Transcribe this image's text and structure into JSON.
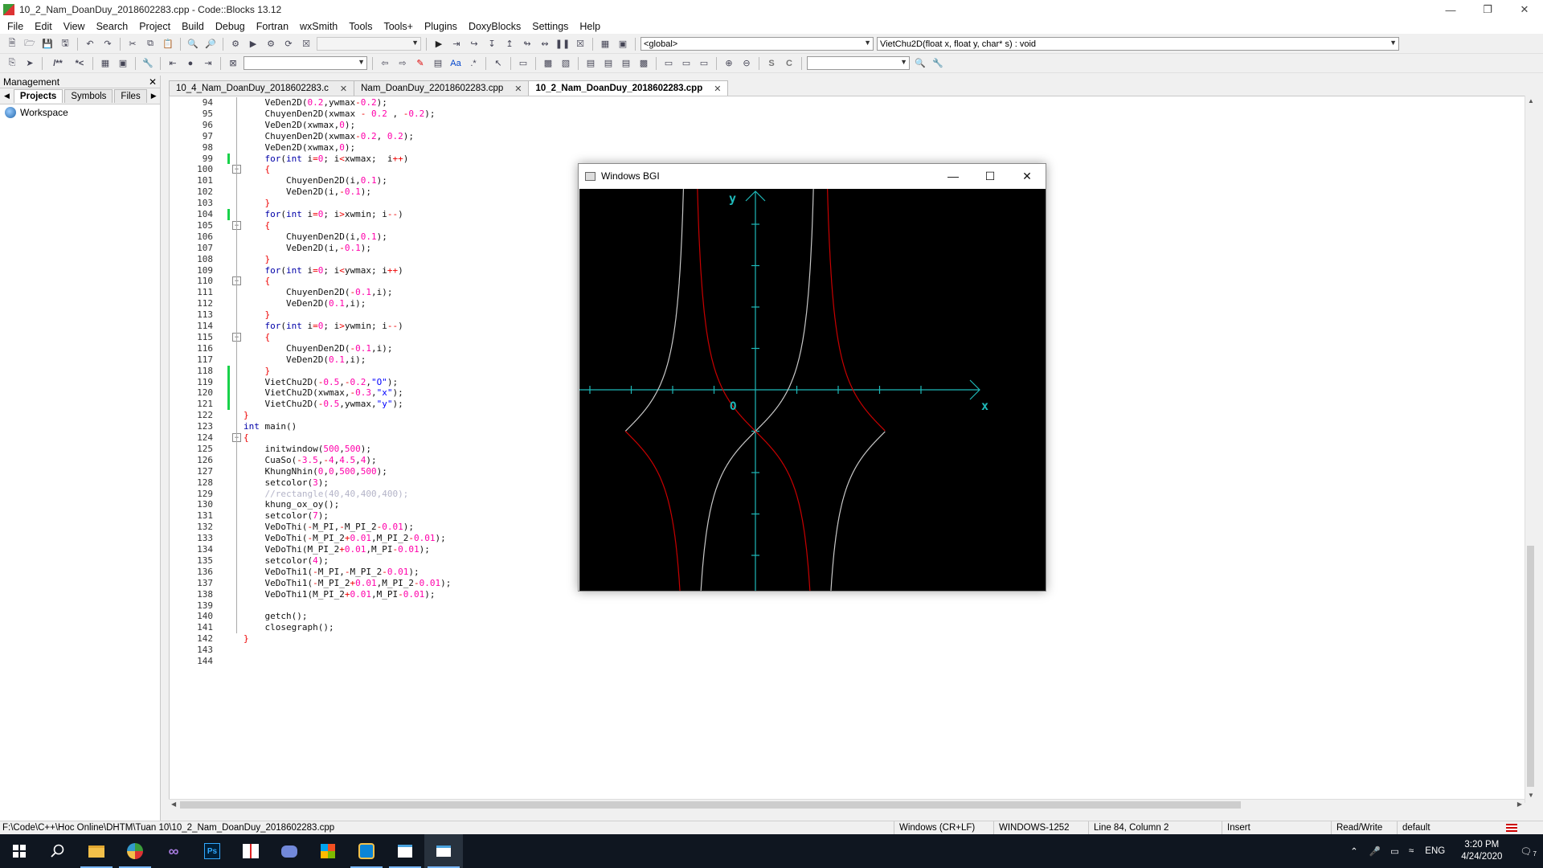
{
  "window": {
    "title": "10_2_Nam_DoanDuy_2018602283.cpp - Code::Blocks 13.12"
  },
  "menu": [
    "File",
    "Edit",
    "View",
    "Search",
    "Project",
    "Build",
    "Debug",
    "Fortran",
    "wxSmith",
    "Tools",
    "Tools+",
    "Plugins",
    "DoxyBlocks",
    "Settings",
    "Help"
  ],
  "toolbar": {
    "scope_combo": "<global>",
    "function_combo": "VietChu2D(float x, float y, char* s) : void",
    "doxy_label": "/**",
    "doxy_label2": "*<"
  },
  "management": {
    "title": "Management",
    "tabs": [
      "Projects",
      "Symbols",
      "Files"
    ],
    "active_tab": "Projects",
    "workspace": "Workspace"
  },
  "editor_tabs": [
    {
      "label": "10_4_Nam_DoanDuy_2018602283.c",
      "active": false
    },
    {
      "label": "Nam_DoanDuy_22018602283.cpp",
      "active": false
    },
    {
      "label": "10_2_Nam_DoanDuy_2018602283.cpp",
      "active": true
    }
  ],
  "code_lines": [
    {
      "n": "94",
      "html": "    VeDen2D(<span class='num'>0.2</span>,ywmax<span class='op'>-</span><span class='num'>0.2</span>);"
    },
    {
      "n": "95",
      "html": "    ChuyenDen2D(xwmax <span class='op'>-</span> <span class='num'>0.2</span> , <span class='op'>-</span><span class='num'>0.2</span>);"
    },
    {
      "n": "96",
      "html": "    VeDen2D(xwmax,<span class='num'>0</span>);"
    },
    {
      "n": "97",
      "html": "    ChuyenDen2D(xwmax<span class='op'>-</span><span class='num'>0.2</span>, <span class='num'>0.2</span>);"
    },
    {
      "n": "98",
      "html": "    VeDen2D(xwmax,<span class='num'>0</span>);"
    },
    {
      "n": "99",
      "html": "    <span class='kw'>for</span>(<span class='kw'>int</span> i<span class='op'>=</span><span class='num'>0</span>; i<span class='op'>&lt;</span>xwmax;  i<span class='op'>++</span>)"
    },
    {
      "n": "100",
      "html": "    <span class='op'>{</span>"
    },
    {
      "n": "101",
      "html": "        ChuyenDen2D(i,<span class='num'>0.1</span>);"
    },
    {
      "n": "102",
      "html": "        VeDen2D(i,<span class='op'>-</span><span class='num'>0.1</span>);"
    },
    {
      "n": "103",
      "html": "    <span class='op'>}</span>"
    },
    {
      "n": "104",
      "html": "    <span class='kw'>for</span>(<span class='kw'>int</span> i<span class='op'>=</span><span class='num'>0</span>; i<span class='op'>&gt;</span>xwmin; i<span class='op'>--</span>)"
    },
    {
      "n": "105",
      "html": "    <span class='op'>{</span>"
    },
    {
      "n": "106",
      "html": "        ChuyenDen2D(i,<span class='num'>0.1</span>);"
    },
    {
      "n": "107",
      "html": "        VeDen2D(i,<span class='op'>-</span><span class='num'>0.1</span>);"
    },
    {
      "n": "108",
      "html": "    <span class='op'>}</span>"
    },
    {
      "n": "109",
      "html": "    <span class='kw'>for</span>(<span class='kw'>int</span> i<span class='op'>=</span><span class='num'>0</span>; i<span class='op'>&lt;</span>ywmax; i<span class='op'>++</span>)"
    },
    {
      "n": "110",
      "html": "    <span class='op'>{</span>"
    },
    {
      "n": "111",
      "html": "        ChuyenDen2D(<span class='op'>-</span><span class='num'>0.1</span>,i);"
    },
    {
      "n": "112",
      "html": "        VeDen2D(<span class='num'>0.1</span>,i);"
    },
    {
      "n": "113",
      "html": "    <span class='op'>}</span>"
    },
    {
      "n": "114",
      "html": "    <span class='kw'>for</span>(<span class='kw'>int</span> i<span class='op'>=</span><span class='num'>0</span>; i<span class='op'>&gt;</span>ywmin; i<span class='op'>--</span>)"
    },
    {
      "n": "115",
      "html": "    <span class='op'>{</span>"
    },
    {
      "n": "116",
      "html": "        ChuyenDen2D(<span class='op'>-</span><span class='num'>0.1</span>,i);"
    },
    {
      "n": "117",
      "html": "        VeDen2D(<span class='num'>0.1</span>,i);"
    },
    {
      "n": "118",
      "html": "    <span class='op'>}</span>"
    },
    {
      "n": "119",
      "html": "    VietChu2D(<span class='op'>-</span><span class='num'>0.5</span>,<span class='op'>-</span><span class='num'>0.2</span>,<span class='str'>\"O\"</span>);"
    },
    {
      "n": "120",
      "html": "    VietChu2D(xwmax,<span class='op'>-</span><span class='num'>0.3</span>,<span class='str'>\"x\"</span>);"
    },
    {
      "n": "121",
      "html": "    VietChu2D(<span class='op'>-</span><span class='num'>0.5</span>,ywmax,<span class='str'>\"y\"</span>);"
    },
    {
      "n": "122",
      "html": "<span class='op'>}</span>"
    },
    {
      "n": "123",
      "html": "<span class='kw'>int</span> main()"
    },
    {
      "n": "124",
      "html": "<span class='op'>{</span>"
    },
    {
      "n": "125",
      "html": "    initwindow(<span class='num'>500</span>,<span class='num'>500</span>);"
    },
    {
      "n": "126",
      "html": "    CuaSo(<span class='op'>-</span><span class='num'>3.5</span>,<span class='op'>-</span><span class='num'>4</span>,<span class='num'>4.5</span>,<span class='num'>4</span>);"
    },
    {
      "n": "127",
      "html": "    KhungNhin(<span class='num'>0</span>,<span class='num'>0</span>,<span class='num'>500</span>,<span class='num'>500</span>);"
    },
    {
      "n": "128",
      "html": "    setcolor(<span class='num'>3</span>);"
    },
    {
      "n": "129",
      "html": "    <span class='cm'>//rectangle(40,40,400,400);</span>"
    },
    {
      "n": "130",
      "html": "    khung_ox_oy();"
    },
    {
      "n": "131",
      "html": "    setcolor(<span class='num'>7</span>);"
    },
    {
      "n": "132",
      "html": "    VeDoThi(<span class='op'>-</span>M_PI,<span class='op'>-</span>M_PI_2<span class='op'>-</span><span class='num'>0.01</span>);"
    },
    {
      "n": "133",
      "html": "    VeDoThi(<span class='op'>-</span>M_PI_2<span class='op'>+</span><span class='num'>0.01</span>,M_PI_2<span class='op'>-</span><span class='num'>0.01</span>);"
    },
    {
      "n": "134",
      "html": "    VeDoThi(M_PI_2<span class='op'>+</span><span class='num'>0.01</span>,M_PI<span class='op'>-</span><span class='num'>0.01</span>);"
    },
    {
      "n": "135",
      "html": "    setcolor(<span class='num'>4</span>);"
    },
    {
      "n": "136",
      "html": "    VeDoThi1(<span class='op'>-</span>M_PI,<span class='op'>-</span>M_PI_2<span class='op'>-</span><span class='num'>0.01</span>);"
    },
    {
      "n": "137",
      "html": "    VeDoThi1(<span class='op'>-</span>M_PI_2<span class='op'>+</span><span class='num'>0.01</span>,M_PI_2<span class='op'>-</span><span class='num'>0.01</span>);"
    },
    {
      "n": "138",
      "html": "    VeDoThi1(M_PI_2<span class='op'>+</span><span class='num'>0.01</span>,M_PI<span class='op'>-</span><span class='num'>0.01</span>);"
    },
    {
      "n": "139",
      "html": ""
    },
    {
      "n": "140",
      "html": "    getch();"
    },
    {
      "n": "141",
      "html": "    closegraph();"
    },
    {
      "n": "142",
      "html": "<span class='op'>}</span>"
    },
    {
      "n": "143",
      "html": ""
    },
    {
      "n": "144",
      "html": ""
    }
  ],
  "bgi_window": {
    "title": "Windows BGI",
    "axis_labels": {
      "x": "x",
      "y": "y",
      "origin": "O"
    },
    "colors": {
      "axes": "#1fb9b9",
      "white_curve": "#c8c8c8",
      "red_curve": "#c80000",
      "background": "#000000"
    }
  },
  "status": {
    "path": "F:\\Code\\C++\\Hoc Online\\DHTM\\Tuan 10\\10_2_Nam_DoanDuy_2018602283.cpp",
    "eol": "Windows (CR+LF)",
    "encoding": "WINDOWS-1252",
    "position": "Line 84, Column 2",
    "mode": "Insert",
    "access": "Read/Write",
    "profile": "default"
  },
  "taskbar": {
    "apps": [
      "windows-start",
      "search",
      "file-explorer",
      "codeblocks",
      "visual-studio",
      "photoshop",
      "app-mosaic",
      "discord",
      "microsoft-store",
      "app-blue",
      "notepad",
      "bgi-window"
    ],
    "lang": "ENG",
    "time": "3:20 PM",
    "date": "4/24/2020",
    "notifications": "7"
  }
}
